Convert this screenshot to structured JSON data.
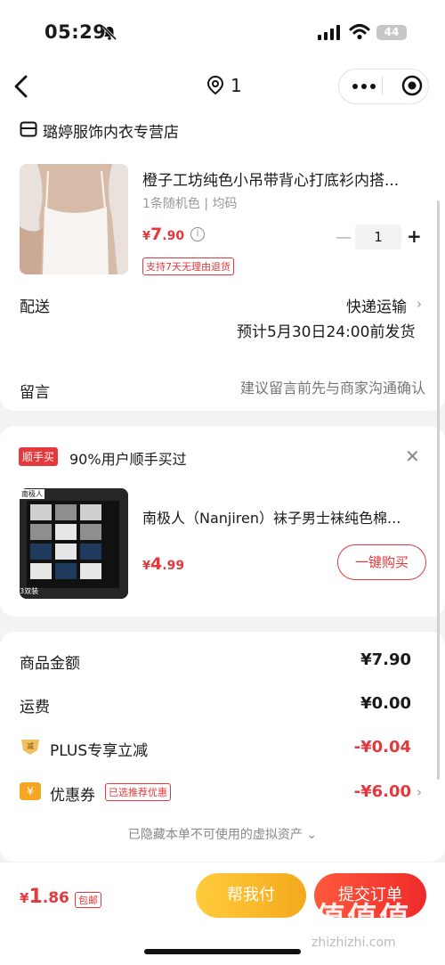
{
  "status_bar": {
    "time": "05:29",
    "battery": "44"
  },
  "nav": {
    "location_count": "1"
  },
  "shop": {
    "name": "璐婷服饰内衣专营店"
  },
  "product": {
    "title": "橙子工坊纯色小吊带背心打底衫内搭...",
    "spec": "1条随机色 | 均码",
    "price_currency": "¥",
    "price_int": "7",
    "price_dec": ".90",
    "return_policy": "支持7天无理由退货",
    "quantity": "1"
  },
  "shipping": {
    "label": "配送",
    "method": "快递运输",
    "eta": "预计5月30日24:00前发货"
  },
  "message": {
    "label": "留言",
    "placeholder": "建议留言前先与商家沟通确认"
  },
  "recommendation": {
    "tag": "顺手买",
    "title": "90%用户顺手买过",
    "product_name": "南极人（Nanjiren）袜子男士袜纯色棉...",
    "price_currency": "¥",
    "price_int": "4",
    "price_dec": ".99",
    "buy_label": "一键购买",
    "image_brand": "南极人",
    "image_caption": "3双装"
  },
  "summary": {
    "rows": [
      {
        "label": "商品金额",
        "value": "¥7.90"
      },
      {
        "label": "运费",
        "value": "¥0.00"
      },
      {
        "label": "PLUS专享立减",
        "value": "-¥0.04"
      },
      {
        "label": "优惠券",
        "value": "-¥6.00"
      }
    ],
    "coupon_tag": "已选推荐优惠",
    "hidden_note": "已隐藏本单不可使用的虚拟资产"
  },
  "bottom_bar": {
    "total_currency": "¥",
    "total_int": "1",
    "total_dec": ".86",
    "postage_tag": "包邮",
    "help_pay_label": "帮我付",
    "submit_label": "提交订单"
  },
  "watermark": {
    "text": "值值值",
    "url": "zhizhizhi.com"
  },
  "colors": {
    "accent_red": "#e4393c",
    "gold": "#f4a91c",
    "background": "#f3f3f3"
  }
}
